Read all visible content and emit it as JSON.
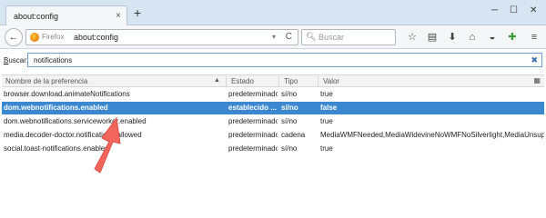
{
  "tab": {
    "title": "about:config",
    "close": "×"
  },
  "newtab": "+",
  "window_controls": {
    "minimize": "─",
    "maximize": "☐",
    "close": "✕"
  },
  "nav": {
    "back": "←",
    "identity_label": "Firefox",
    "url": "about:config",
    "reload": "C",
    "dropdown": "▾",
    "search_placeholder": "Buscar",
    "toolbar_icons": [
      "star-icon",
      "reading-list-icon",
      "download-icon",
      "home-icon",
      "pocket-icon",
      "addon-icon",
      "menu-icon"
    ]
  },
  "filter": {
    "label_prefix": "B",
    "label_rest": "uscar:",
    "value": "notifications",
    "clear": "✖"
  },
  "table": {
    "headers": {
      "name": "Nombre de la preferencia",
      "estado": "Estado",
      "tipo": "Tipo",
      "valor": "Valor"
    },
    "sort_indicator": "▲",
    "rows": [
      {
        "name": "browser.download.animateNotifications",
        "estado": "predeterminado",
        "tipo": "sí/no",
        "valor": "true",
        "selected": false
      },
      {
        "name": "dom.webnotifications.enabled",
        "estado": "establecido ...",
        "tipo": "sí/no",
        "valor": "false",
        "selected": true
      },
      {
        "name": "dom.webnotifications.serviceworker.enabled",
        "estado": "predeterminado",
        "tipo": "sí/no",
        "valor": "true",
        "selected": false
      },
      {
        "name": "media.decoder-doctor.notifications-allowed",
        "estado": "predeterminado",
        "tipo": "cadena",
        "valor": "MediaWMFNeeded,MediaWidevineNoWMFNoSilverlight,MediaUnsupportedLibavcodec",
        "selected": false
      },
      {
        "name": "social.toast-notifications.enabled",
        "estado": "predeterminado",
        "tipo": "sí/no",
        "valor": "true",
        "selected": false
      }
    ]
  },
  "colors": {
    "selected_row": "#3c88d0",
    "annotation_arrow": "#f2665e",
    "titlebar": "#d7e4f2"
  }
}
